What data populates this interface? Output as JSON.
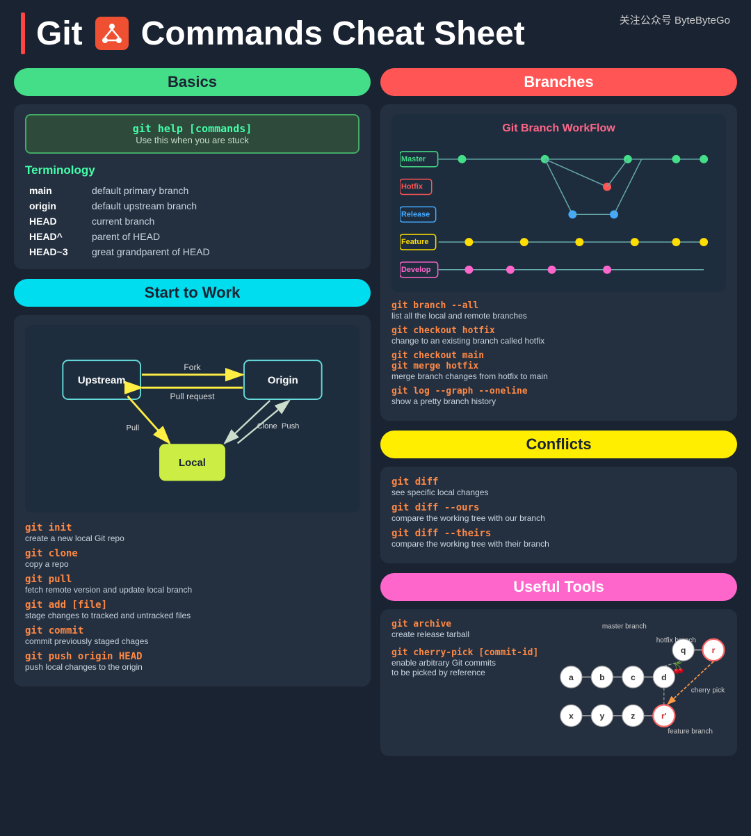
{
  "header": {
    "title": "Git",
    "subtitle": "Commands Cheat Sheet",
    "watermark": "关注公众号 ByteByteGo"
  },
  "basics": {
    "section_title": "Basics",
    "help_cmd": "git help [commands]",
    "help_desc": "Use this when you are stuck",
    "terminology_title": "Terminology",
    "terms": [
      {
        "term": "main",
        "desc": "default primary branch"
      },
      {
        "term": "origin",
        "desc": "default upstream branch"
      },
      {
        "term": "HEAD",
        "desc": "current branch"
      },
      {
        "term": "HEAD^",
        "desc": "parent of HEAD"
      },
      {
        "term": "HEAD~3",
        "desc": "great grandparent of HEAD"
      }
    ]
  },
  "start_to_work": {
    "section_title": "Start to Work",
    "nodes": {
      "upstream": "Upstream",
      "origin": "Origin",
      "local": "Local"
    },
    "arrows": {
      "fork": "Fork",
      "pull_request": "Pull request",
      "clone": "Clone",
      "push": "Push",
      "pull": "Pull"
    },
    "commands": [
      {
        "cmd": "git init",
        "desc": "create a new local Git repo"
      },
      {
        "cmd": "git clone",
        "desc": "copy a repo"
      },
      {
        "cmd": "git pull",
        "desc": "fetch remote version and update local branch"
      },
      {
        "cmd": "git add [file]",
        "desc": "stage changes to tracked and untracked files"
      },
      {
        "cmd": "git commit",
        "desc": "commit previously staged chages"
      },
      {
        "cmd": "git push origin HEAD",
        "desc": "push local changes to the origin"
      }
    ]
  },
  "branches": {
    "section_title": "Branches",
    "workflow_title": "Git Branch WorkFlow",
    "branch_labels": [
      "Master",
      "Hotfix",
      "Release",
      "Feature",
      "Develop"
    ],
    "commands": [
      {
        "cmd": "git branch --all",
        "desc": "list all the local and remote branches"
      },
      {
        "cmd": "git checkout hotfix",
        "desc": "change to an existing branch called hotfix"
      },
      {
        "cmd": "git checkout main\ngit merge hotfix",
        "desc": "merge branch changes from hotfix to main"
      },
      {
        "cmd": "git log --graph --oneline",
        "desc": "show a pretty branch history"
      }
    ]
  },
  "conflicts": {
    "section_title": "Conflicts",
    "commands": [
      {
        "cmd": "git diff",
        "desc": "see specific local changes"
      },
      {
        "cmd": "git diff --ours",
        "desc": "compare the working tree with our branch"
      },
      {
        "cmd": "git diff --theirs",
        "desc": "compare the working tree with their branch"
      }
    ]
  },
  "useful_tools": {
    "section_title": "Useful Tools",
    "commands": [
      {
        "cmd": "git archive",
        "desc": "create release tarball"
      },
      {
        "cmd": "git cherry-pick [commit-id]",
        "desc": "enable arbitrary Git commits\nto be picked by reference"
      }
    ],
    "diagram_labels": {
      "master_branch": "master branch",
      "hotfix_branch": "hotfix branch",
      "feature_branch": "feature branch",
      "cherry_pick": "cherry pick",
      "nodes_master": [
        "a",
        "b",
        "c",
        "d"
      ],
      "nodes_second": [
        "x",
        "y",
        "z"
      ],
      "nodes_hotfix": [
        "q",
        "r"
      ],
      "node_r2": "r"
    }
  }
}
